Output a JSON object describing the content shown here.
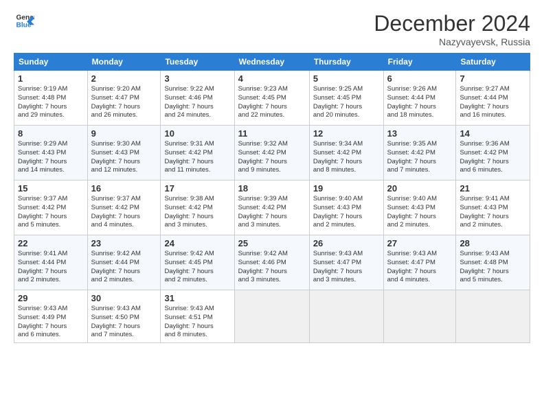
{
  "header": {
    "logo_line1": "General",
    "logo_line2": "Blue",
    "month": "December 2024",
    "location": "Nazyvayevsk, Russia"
  },
  "weekdays": [
    "Sunday",
    "Monday",
    "Tuesday",
    "Wednesday",
    "Thursday",
    "Friday",
    "Saturday"
  ],
  "weeks": [
    [
      {
        "day": "1",
        "info": "Sunrise: 9:19 AM\nSunset: 4:48 PM\nDaylight: 7 hours\nand 29 minutes."
      },
      {
        "day": "2",
        "info": "Sunrise: 9:20 AM\nSunset: 4:47 PM\nDaylight: 7 hours\nand 26 minutes."
      },
      {
        "day": "3",
        "info": "Sunrise: 9:22 AM\nSunset: 4:46 PM\nDaylight: 7 hours\nand 24 minutes."
      },
      {
        "day": "4",
        "info": "Sunrise: 9:23 AM\nSunset: 4:45 PM\nDaylight: 7 hours\nand 22 minutes."
      },
      {
        "day": "5",
        "info": "Sunrise: 9:25 AM\nSunset: 4:45 PM\nDaylight: 7 hours\nand 20 minutes."
      },
      {
        "day": "6",
        "info": "Sunrise: 9:26 AM\nSunset: 4:44 PM\nDaylight: 7 hours\nand 18 minutes."
      },
      {
        "day": "7",
        "info": "Sunrise: 9:27 AM\nSunset: 4:44 PM\nDaylight: 7 hours\nand 16 minutes."
      }
    ],
    [
      {
        "day": "8",
        "info": "Sunrise: 9:29 AM\nSunset: 4:43 PM\nDaylight: 7 hours\nand 14 minutes."
      },
      {
        "day": "9",
        "info": "Sunrise: 9:30 AM\nSunset: 4:43 PM\nDaylight: 7 hours\nand 12 minutes."
      },
      {
        "day": "10",
        "info": "Sunrise: 9:31 AM\nSunset: 4:42 PM\nDaylight: 7 hours\nand 11 minutes."
      },
      {
        "day": "11",
        "info": "Sunrise: 9:32 AM\nSunset: 4:42 PM\nDaylight: 7 hours\nand 9 minutes."
      },
      {
        "day": "12",
        "info": "Sunrise: 9:34 AM\nSunset: 4:42 PM\nDaylight: 7 hours\nand 8 minutes."
      },
      {
        "day": "13",
        "info": "Sunrise: 9:35 AM\nSunset: 4:42 PM\nDaylight: 7 hours\nand 7 minutes."
      },
      {
        "day": "14",
        "info": "Sunrise: 9:36 AM\nSunset: 4:42 PM\nDaylight: 7 hours\nand 6 minutes."
      }
    ],
    [
      {
        "day": "15",
        "info": "Sunrise: 9:37 AM\nSunset: 4:42 PM\nDaylight: 7 hours\nand 5 minutes."
      },
      {
        "day": "16",
        "info": "Sunrise: 9:37 AM\nSunset: 4:42 PM\nDaylight: 7 hours\nand 4 minutes."
      },
      {
        "day": "17",
        "info": "Sunrise: 9:38 AM\nSunset: 4:42 PM\nDaylight: 7 hours\nand 3 minutes."
      },
      {
        "day": "18",
        "info": "Sunrise: 9:39 AM\nSunset: 4:42 PM\nDaylight: 7 hours\nand 3 minutes."
      },
      {
        "day": "19",
        "info": "Sunrise: 9:40 AM\nSunset: 4:43 PM\nDaylight: 7 hours\nand 2 minutes."
      },
      {
        "day": "20",
        "info": "Sunrise: 9:40 AM\nSunset: 4:43 PM\nDaylight: 7 hours\nand 2 minutes."
      },
      {
        "day": "21",
        "info": "Sunrise: 9:41 AM\nSunset: 4:43 PM\nDaylight: 7 hours\nand 2 minutes."
      }
    ],
    [
      {
        "day": "22",
        "info": "Sunrise: 9:41 AM\nSunset: 4:44 PM\nDaylight: 7 hours\nand 2 minutes."
      },
      {
        "day": "23",
        "info": "Sunrise: 9:42 AM\nSunset: 4:44 PM\nDaylight: 7 hours\nand 2 minutes."
      },
      {
        "day": "24",
        "info": "Sunrise: 9:42 AM\nSunset: 4:45 PM\nDaylight: 7 hours\nand 2 minutes."
      },
      {
        "day": "25",
        "info": "Sunrise: 9:42 AM\nSunset: 4:46 PM\nDaylight: 7 hours\nand 3 minutes."
      },
      {
        "day": "26",
        "info": "Sunrise: 9:43 AM\nSunset: 4:47 PM\nDaylight: 7 hours\nand 3 minutes."
      },
      {
        "day": "27",
        "info": "Sunrise: 9:43 AM\nSunset: 4:47 PM\nDaylight: 7 hours\nand 4 minutes."
      },
      {
        "day": "28",
        "info": "Sunrise: 9:43 AM\nSunset: 4:48 PM\nDaylight: 7 hours\nand 5 minutes."
      }
    ],
    [
      {
        "day": "29",
        "info": "Sunrise: 9:43 AM\nSunset: 4:49 PM\nDaylight: 7 hours\nand 6 minutes."
      },
      {
        "day": "30",
        "info": "Sunrise: 9:43 AM\nSunset: 4:50 PM\nDaylight: 7 hours\nand 7 minutes."
      },
      {
        "day": "31",
        "info": "Sunrise: 9:43 AM\nSunset: 4:51 PM\nDaylight: 7 hours\nand 8 minutes."
      },
      null,
      null,
      null,
      null
    ]
  ]
}
